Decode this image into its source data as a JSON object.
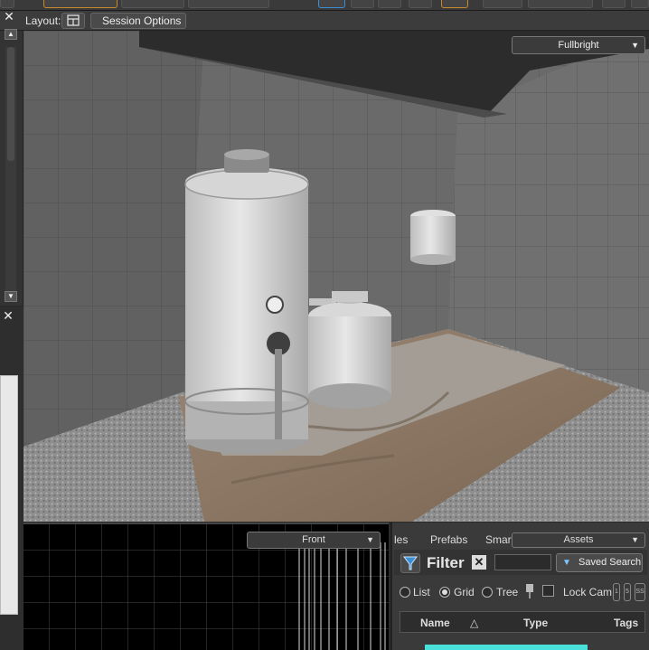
{
  "toolbar": {
    "close_label": "✕",
    "layout_label": "Layout:",
    "session_options_label": "Session Options"
  },
  "viewport_3d": {
    "render_mode": "Fullbright",
    "scene_label": "3D viewport showing water heater, tank and cylinder in tiled room"
  },
  "left_panel": {
    "scroll_up": "▲",
    "scroll_down": "▼",
    "close_label": "✕"
  },
  "viewport_front": {
    "view_label": "Front"
  },
  "assets_panel": {
    "tabs": [
      "les",
      "Prefabs",
      "Smart"
    ],
    "dropdown_label": "Assets",
    "filter_label": "Filter",
    "filter_clear": "✕",
    "filter_value": "",
    "saved_search_label": "Saved Search",
    "view_modes": [
      "List",
      "Grid",
      "Tree"
    ],
    "selected_view_mode": "Grid",
    "lock_cam_label": "Lock Cam",
    "lock_cam_checked": false,
    "size_labels": [
      "1",
      "5",
      "SS"
    ],
    "columns": [
      "Name",
      "Type",
      "Tags"
    ],
    "sort_icon": "△"
  },
  "colors": {
    "accent_cyan": "#48e0d8",
    "filter_icon_blue": "#3a8fd6"
  }
}
